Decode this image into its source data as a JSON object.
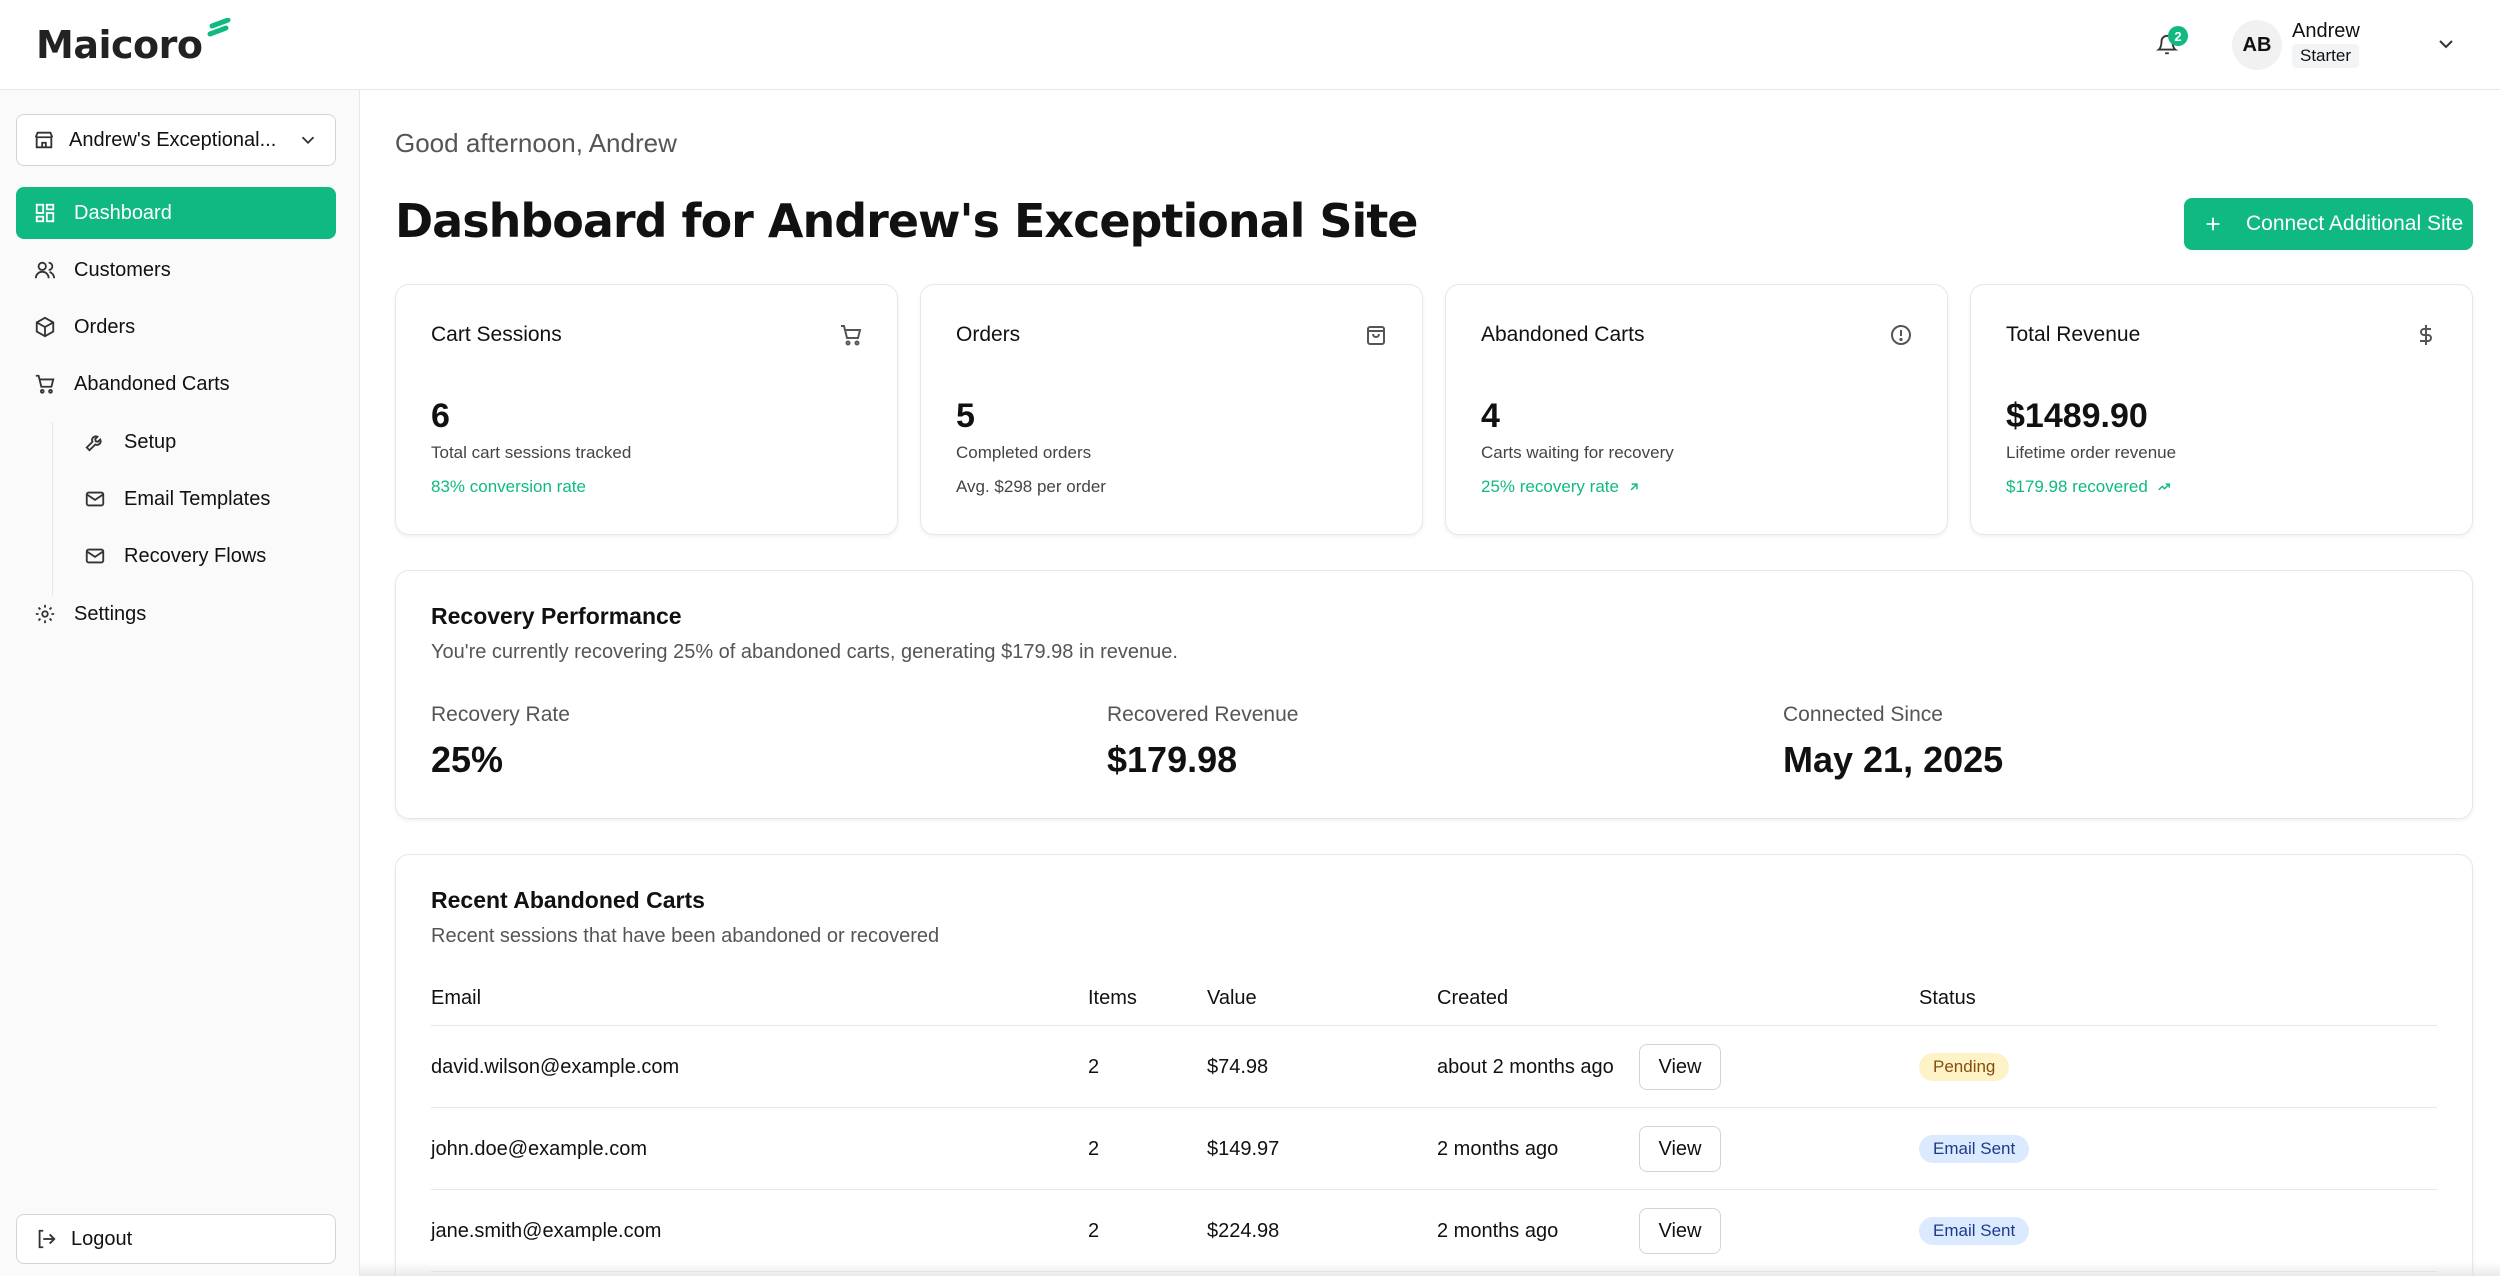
{
  "header": {
    "logo_text": "Maicoro",
    "notification_count": "2",
    "avatar_initials": "AB",
    "user_name": "Andrew",
    "user_plan": "Starter"
  },
  "sidebar": {
    "site_selector": "Andrew's Exceptional...",
    "items": [
      {
        "label": "Dashboard",
        "icon": "dashboard-icon",
        "active": true
      },
      {
        "label": "Customers",
        "icon": "users-icon"
      },
      {
        "label": "Orders",
        "icon": "package-icon"
      },
      {
        "label": "Abandoned Carts",
        "icon": "cart-icon"
      },
      {
        "label": "Setup",
        "icon": "wrench-icon"
      },
      {
        "label": "Email Templates",
        "icon": "mail-icon"
      },
      {
        "label": "Recovery Flows",
        "icon": "mail-icon"
      },
      {
        "label": "Settings",
        "icon": "gear-icon"
      }
    ],
    "logout": "Logout"
  },
  "main": {
    "greeting": "Good afternoon, Andrew",
    "title": "Dashboard for Andrew's Exceptional Site",
    "connect_button": "Connect Additional Site",
    "stats": [
      {
        "title": "Cart Sessions",
        "value": "6",
        "sub": "Total cart sessions tracked",
        "extra": "83% conversion rate",
        "icon": "cart-icon"
      },
      {
        "title": "Orders",
        "value": "5",
        "sub": "Completed orders",
        "extra": "Avg. $298 per order",
        "icon": "bag-icon"
      },
      {
        "title": "Abandoned Carts",
        "value": "4",
        "sub": "Carts waiting for recovery",
        "extra": "25% recovery rate",
        "icon": "alert-circle-icon"
      },
      {
        "title": "Total Revenue",
        "value": "$1489.90",
        "sub": "Lifetime order revenue",
        "extra": "$179.98 recovered",
        "icon": "dollar-icon"
      }
    ],
    "performance": {
      "title": "Recovery Performance",
      "description": "You're currently recovering 25% of abandoned carts, generating $179.98 in revenue.",
      "metrics": [
        {
          "label": "Recovery Rate",
          "value": "25%"
        },
        {
          "label": "Recovered Revenue",
          "value": "$179.98"
        },
        {
          "label": "Connected Since",
          "value": "May 21, 2025"
        }
      ]
    },
    "recent": {
      "title": "Recent Abandoned Carts",
      "description": "Recent sessions that have been abandoned or recovered",
      "columns": [
        "Email",
        "Items",
        "Value",
        "Created",
        "Status"
      ],
      "rows": [
        {
          "email": "david.wilson@example.com",
          "items": "2",
          "value": "$74.98",
          "created": "about 2 months ago",
          "status": "Pending",
          "action": "View"
        },
        {
          "email": "john.doe@example.com",
          "items": "2",
          "value": "$149.97",
          "created": "2 months ago",
          "status": "Email Sent",
          "action": "View"
        },
        {
          "email": "jane.smith@example.com",
          "items": "2",
          "value": "$224.98",
          "created": "2 months ago",
          "status": "Email Sent",
          "action": "View"
        }
      ]
    }
  },
  "colors": {
    "accent": "#10b981",
    "pending_bg": "#fef3c7",
    "sent_bg": "#dbeafe"
  }
}
